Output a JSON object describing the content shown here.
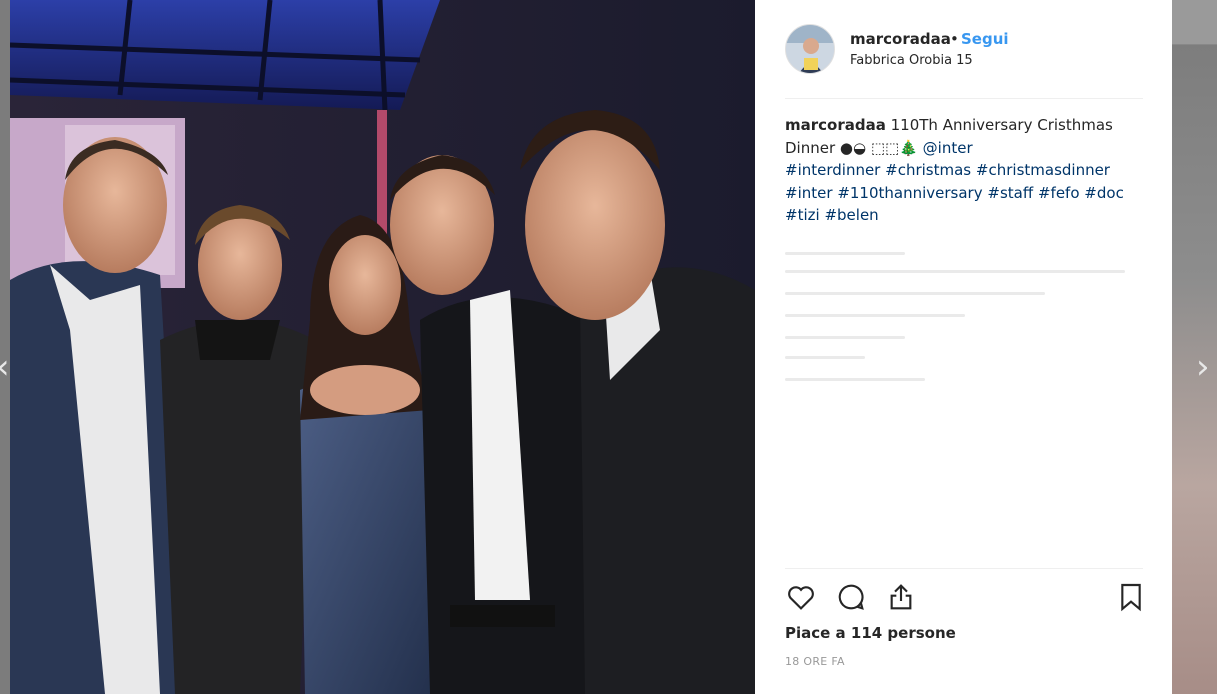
{
  "post": {
    "username": "marcoradaa",
    "separator": "•",
    "follow_label": "Segui",
    "location": "Fabbrica Orobia 15"
  },
  "caption": {
    "username": "marcoradaa",
    "text": "110Th Anniversary Cristhmas Dinner ●◒ ⬚⬚🎄",
    "mention": "@inter",
    "hashtags": [
      "#interdinner",
      "#christmas",
      "#christmasdinner",
      "#inter",
      "#110thanniversary",
      "#staff",
      "#fefo",
      "#doc",
      "#tizi",
      "#belen"
    ]
  },
  "engagement": {
    "likes_text": "Piace a 114 persone",
    "time_text": "18 ORE FA"
  },
  "icons": {
    "like": "heart-icon",
    "comment": "comment-icon",
    "share": "share-icon",
    "save": "bookmark-icon",
    "prev": "chevron-left-icon",
    "next": "chevron-right-icon"
  },
  "colors": {
    "link": "#3897f0",
    "hashtag": "#003569",
    "text": "#262626",
    "muted": "#999999"
  }
}
